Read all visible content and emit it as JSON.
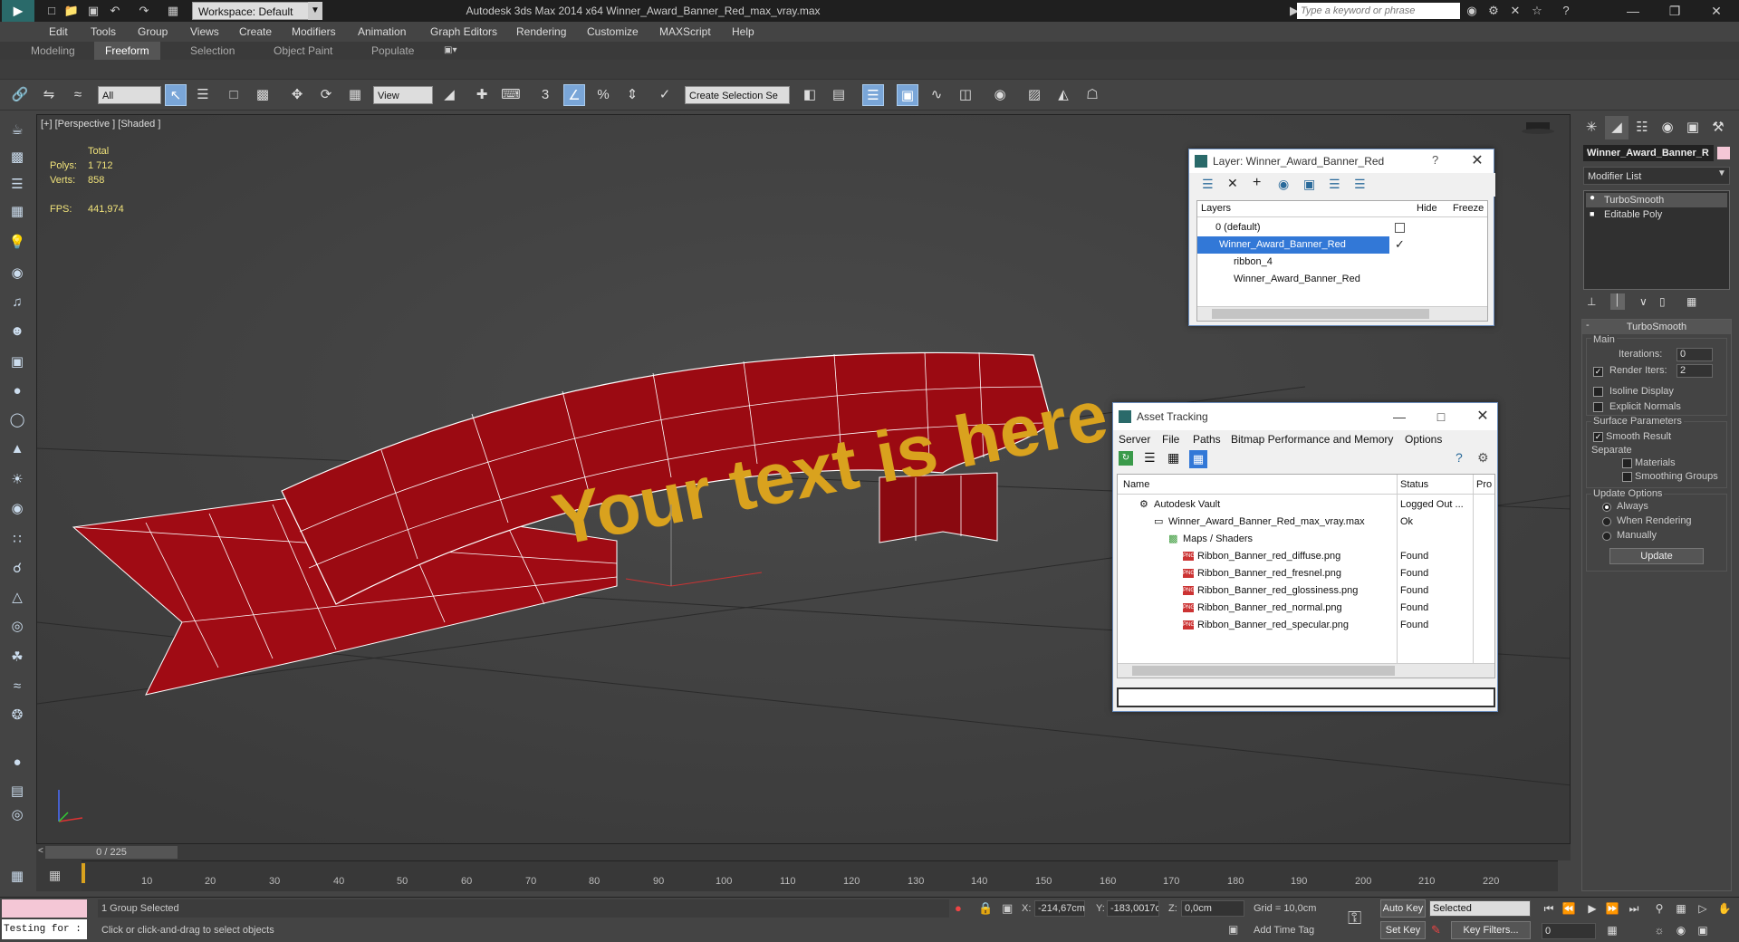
{
  "app": {
    "title": "Autodesk 3ds Max  2014 x64     Winner_Award_Banner_Red_max_vray.max",
    "workspace": "Workspace: Default",
    "search_placeholder": "Type a keyword or phrase"
  },
  "menu": [
    "Edit",
    "Tools",
    "Group",
    "Views",
    "Create",
    "Modifiers",
    "Animation",
    "Graph Editors",
    "Rendering",
    "Customize",
    "MAXScript",
    "Help"
  ],
  "ribbon_tabs": [
    "Modeling",
    "Freeform",
    "Selection",
    "Object Paint",
    "Populate"
  ],
  "toolbar": {
    "filter_value": "All",
    "refcoord_value": "View",
    "named_sel_value": "Create Selection Se"
  },
  "viewport": {
    "label": "[+] [Perspective ] [Shaded ]",
    "stats_header": "Total",
    "polys_label": "Polys:",
    "polys_value": "1 712",
    "verts_label": "Verts:",
    "verts_value": "858",
    "fps_label": "FPS:",
    "fps_value": "441,974",
    "banner_text": "Your text is here",
    "banner_color": "#9b0a12",
    "text_color": "#d9a21e"
  },
  "layer_dialog": {
    "title": "Layer: Winner_Award_Banner_Red",
    "help": "?",
    "columns": {
      "name": "Layers",
      "hide": "Hide",
      "freeze": "Freeze"
    },
    "rows": [
      {
        "name": "0 (default)"
      },
      {
        "name": "Winner_Award_Banner_Red"
      },
      {
        "name": "ribbon_4"
      },
      {
        "name": "Winner_Award_Banner_Red"
      }
    ]
  },
  "asset_dialog": {
    "title": "Asset Tracking",
    "menu": [
      "Server",
      "File",
      "Paths",
      "Bitmap Performance and Memory",
      "Options"
    ],
    "columns": {
      "name": "Name",
      "status": "Status",
      "proxy": "Pro"
    },
    "rows": [
      {
        "name": "Autodesk Vault",
        "status": "Logged Out ..."
      },
      {
        "name": "Winner_Award_Banner_Red_max_vray.max",
        "status": "Ok"
      },
      {
        "name": "Maps / Shaders",
        "status": ""
      },
      {
        "name": "Ribbon_Banner_red_diffuse.png",
        "status": "Found"
      },
      {
        "name": "Ribbon_Banner_red_fresnel.png",
        "status": "Found"
      },
      {
        "name": "Ribbon_Banner_red_glossiness.png",
        "status": "Found"
      },
      {
        "name": "Ribbon_Banner_red_normal.png",
        "status": "Found"
      },
      {
        "name": "Ribbon_Banner_red_specular.png",
        "status": "Found"
      }
    ],
    "png_label": "PNG"
  },
  "command_panel": {
    "object_name": "Winner_Award_Banner_R",
    "object_color": "#f4c7d6",
    "modifier_list": "Modifier List",
    "stack": [
      "TurboSmooth",
      "Editable Poly"
    ],
    "rollout_title": "TurboSmooth",
    "main_label": "Main",
    "iterations_label": "Iterations:",
    "iterations_value": "0",
    "render_iters_label": "Render Iters:",
    "render_iters_value": "2",
    "isoline": "Isoline Display",
    "explicit_normals": "Explicit Normals",
    "surface_params": "Surface Parameters",
    "smooth_result": "Smooth Result",
    "separate": "Separate",
    "materials": "Materials",
    "smoothing_groups": "Smoothing Groups",
    "update_options": "Update Options",
    "always": "Always",
    "when_rendering": "When Rendering",
    "manually": "Manually",
    "update_btn": "Update"
  },
  "timeline": {
    "slider": "0 / 225",
    "ticks": [
      "10",
      "20",
      "30",
      "40",
      "50",
      "60",
      "70",
      "80",
      "90",
      "100",
      "110",
      "120",
      "130",
      "140",
      "150",
      "160",
      "170",
      "180",
      "190",
      "200",
      "210",
      "220"
    ]
  },
  "status": {
    "maxscript": "Testing for :",
    "selection": "1 Group Selected",
    "prompt": "Click or click-and-drag to select objects",
    "x_label": "X:",
    "x_value": "-214,67cm",
    "y_label": "Y:",
    "y_value": "-183,0017c",
    "z_label": "Z:",
    "z_value": "0,0cm",
    "grid": "Grid = 10,0cm",
    "add_time_tag": "Add Time Tag",
    "auto_key": "Auto Key",
    "auto_key_value": "Selected",
    "set_key": "Set Key",
    "key_filters": "Key Filters...",
    "frame_value": "0"
  }
}
